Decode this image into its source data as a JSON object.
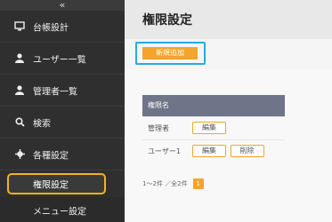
{
  "sidebar": {
    "collapse_label": "«",
    "items": [
      {
        "label": "台帳設計",
        "icon": "monitor-icon"
      },
      {
        "label": "ユーザー一覧",
        "icon": "user-icon"
      },
      {
        "label": "管理者一覧",
        "icon": "user-icon"
      },
      {
        "label": "検索",
        "icon": "search-icon"
      },
      {
        "label": "各種設定",
        "icon": "gear-icon"
      }
    ],
    "sub_items": [
      {
        "label": "権限設定"
      },
      {
        "label": "メニュー設定"
      }
    ]
  },
  "main": {
    "title": "権限設定",
    "add_button": "新規追加",
    "table": {
      "header": [
        "権限名",
        ""
      ],
      "rows": [
        {
          "name": "管理者",
          "edit": "編集",
          "delete": null
        },
        {
          "name": "ユーザー1",
          "edit": "編集",
          "delete": "削除"
        }
      ]
    },
    "pager": {
      "summary": "1〜2件 ／全2件",
      "current_page": "1"
    }
  },
  "colors": {
    "sidebar_bg": "#2f2f2f",
    "accent_orange": "#f2a42b",
    "highlight_blue": "#2aa9df",
    "highlight_yellow": "#f3b31b",
    "table_header": "#6f7488"
  }
}
